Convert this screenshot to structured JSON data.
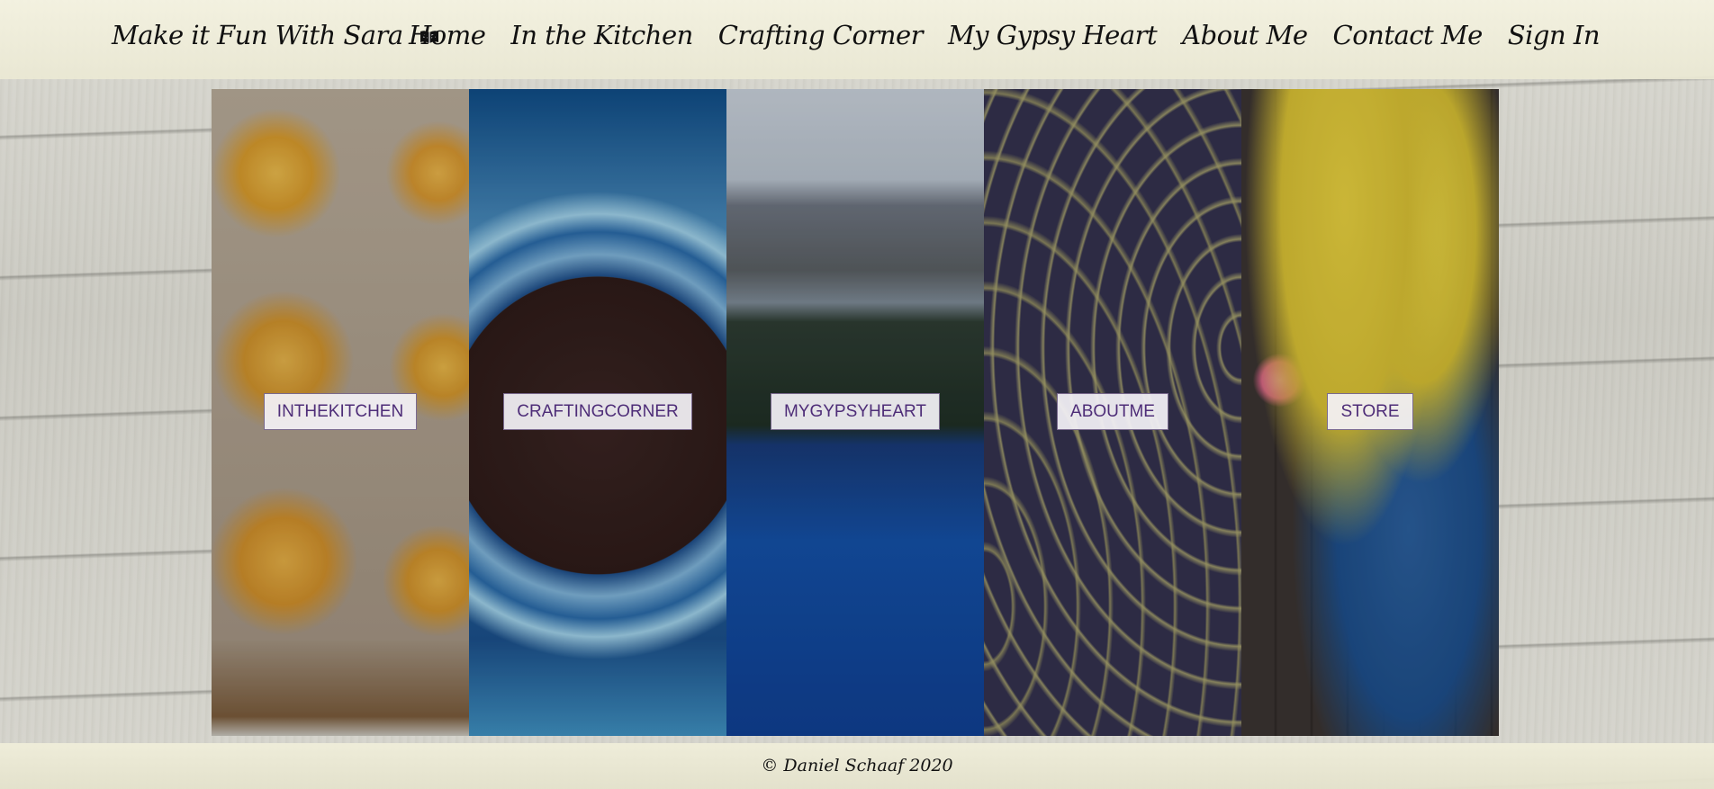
{
  "header": {
    "brand": "Make it Fun With Sara",
    "brand_icon": "open-book-icon",
    "nav": [
      "Home",
      "In the Kitchen",
      "Crafting Corner",
      "My Gypsy Heart",
      "About Me",
      "Contact Me",
      "Sign In"
    ]
  },
  "panels": [
    {
      "label": "INTHEKITCHEN",
      "image": "pasta-nests-photo"
    },
    {
      "label": "CRAFTINGCORNER",
      "image": "tutu-wreath-photo"
    },
    {
      "label": "MYGYPSYHEART",
      "image": "mountain-lake-photo"
    },
    {
      "label": "ABOUTME",
      "image": "peacock-feather-pattern"
    },
    {
      "label": "STORE",
      "image": "craft-supplies-photo"
    }
  ],
  "footer": {
    "copyright": "© Daniel Schaaf 2020"
  },
  "colors": {
    "label_text": "#4e2d78",
    "header_bg": "#f2f0dc"
  }
}
